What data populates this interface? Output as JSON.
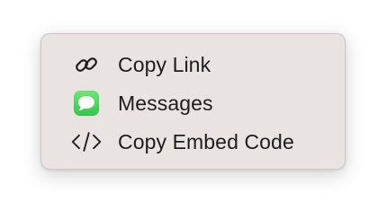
{
  "menu": {
    "items": [
      {
        "label": "Copy Link",
        "icon": "link-icon"
      },
      {
        "label": "Messages",
        "icon": "messages-app-icon",
        "icon_color": "#34c74a"
      },
      {
        "label": "Copy Embed Code",
        "icon": "code-brackets-icon"
      }
    ]
  },
  "colors": {
    "menu_background": "#e9e3e1",
    "text": "#1d1d1f",
    "messages_green": "#34c74a"
  }
}
